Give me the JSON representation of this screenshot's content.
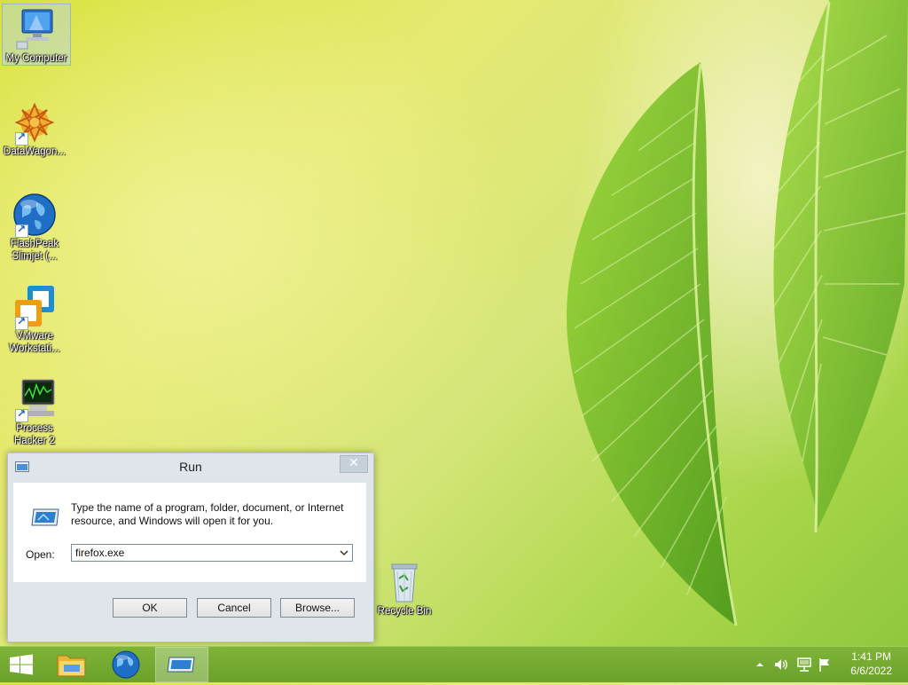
{
  "desktop": {
    "icons": [
      {
        "label": "My Computer"
      },
      {
        "label": "DataWagon..."
      },
      {
        "label": "FlashPeak Slimjet (..."
      },
      {
        "label": "VMware Workstati..."
      },
      {
        "label": "Process Hacker 2"
      },
      {
        "label": "Recycle Bin"
      }
    ]
  },
  "run_dialog": {
    "title": "Run",
    "description": "Type the name of a program, folder, document, or Internet resource, and Windows will open it for you.",
    "open_label": "Open:",
    "open_value": "firefox.exe",
    "buttons": {
      "ok": "OK",
      "cancel": "Cancel",
      "browse": "Browse..."
    }
  },
  "taskbar": {
    "pinned": [
      "start-icon",
      "file-explorer-icon",
      "browser-globe-icon",
      "run-window-icon"
    ],
    "clock": {
      "time": "1:41 PM",
      "date": "6/6/2022"
    }
  },
  "colors": {
    "taskbar": "#74aa30",
    "dialog_frame": "#dfe5ea",
    "accent_blue": "#1e6fc2"
  }
}
